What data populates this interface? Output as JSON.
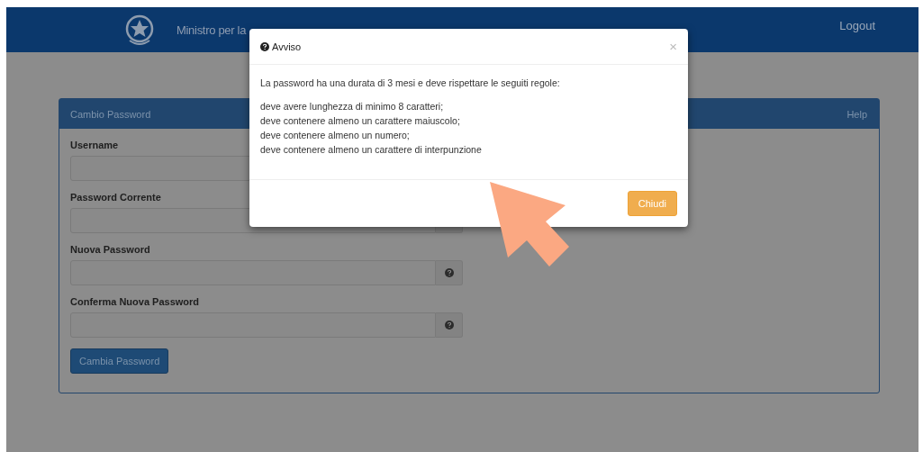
{
  "header": {
    "title": "Ministro per la",
    "logout": "Logout"
  },
  "panel": {
    "title": "Cambio Password",
    "help": "Help",
    "fields": [
      {
        "label": "Username",
        "kind": "plain"
      },
      {
        "label": "Password Corrente",
        "kind": "addon"
      },
      {
        "label": "Nuova Password",
        "kind": "help"
      },
      {
        "label": "Conferma Nuova Password",
        "kind": "help"
      }
    ],
    "submit": "Cambia Password"
  },
  "modal": {
    "title": "Avviso",
    "close_symbol": "×",
    "message": "La password ha una durata di 3 mesi e deve rispettare le seguiti regole:",
    "rules": [
      "deve avere lunghezza di minimo 8 caratteri;",
      "deve contenere almeno un carattere maiuscolo;",
      "deve contenere almeno un numero;",
      "deve contenere almeno un carattere di interpunzione"
    ],
    "close_button": "Chiudi"
  }
}
